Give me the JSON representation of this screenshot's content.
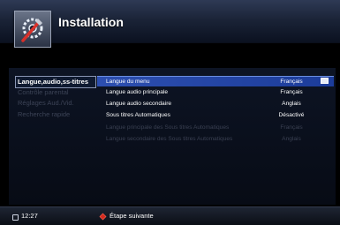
{
  "header": {
    "title": "Installation",
    "icon": "settings-tools-icon"
  },
  "categories": [
    {
      "label": "Langue,audio,ss-titres",
      "active": true
    },
    {
      "label": "Contrôle parental",
      "active": false
    },
    {
      "label": "Réglages Aud./Vid.",
      "active": false
    },
    {
      "label": "Recherche rapide",
      "active": false
    }
  ],
  "options": [
    {
      "label": "Langue du menu",
      "value": "Français",
      "state": "selected"
    },
    {
      "label": "Langue audio principale",
      "value": "Français",
      "state": "normal"
    },
    {
      "label": "Langue audio secondaire",
      "value": "Anglais",
      "state": "normal"
    },
    {
      "label": "Sous titres Automatiques",
      "value": "Désactivé",
      "state": "normal"
    },
    {
      "label": "Langue principale des Sous titres Automatiques",
      "value": "Français",
      "state": "disabled"
    },
    {
      "label": "Langue secondaire des Sous titres Automatiques",
      "value": "Anglais",
      "state": "disabled"
    }
  ],
  "footer": {
    "time": "12:27",
    "next_step": "Étape suivante",
    "red_button_color": "#d42a1e"
  },
  "colors": {
    "selection": "#2d4fb0",
    "header": "#1b2438"
  }
}
